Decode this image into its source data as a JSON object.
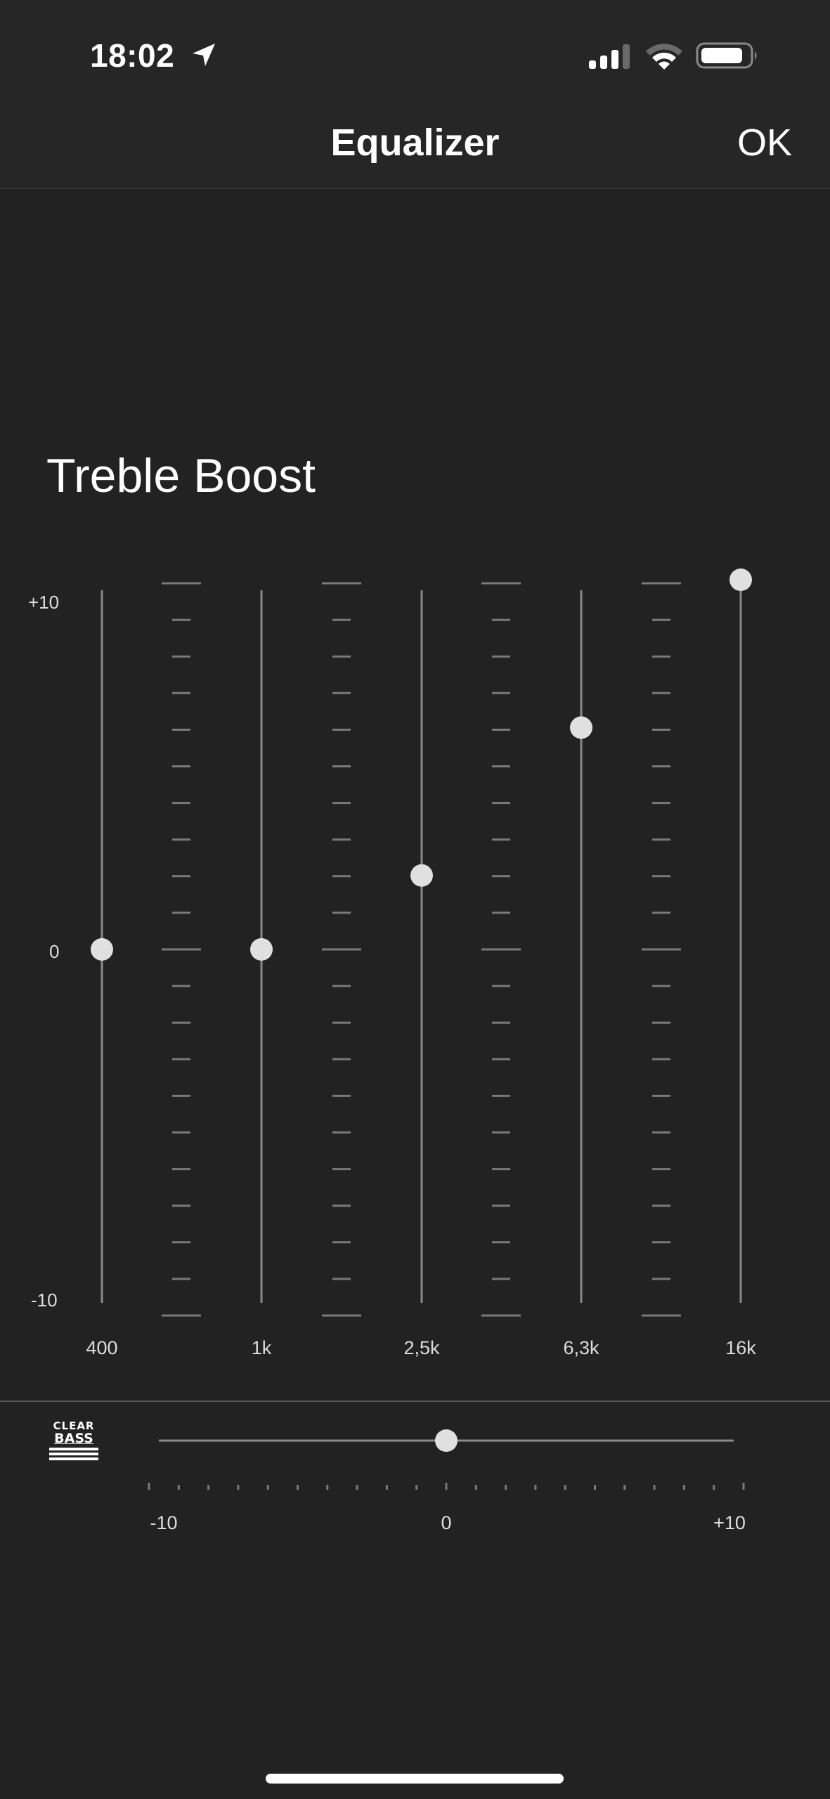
{
  "status_bar": {
    "time": "18:02",
    "icons": [
      "location-arrow-icon",
      "signal-icon",
      "wifi-icon",
      "battery-icon"
    ]
  },
  "nav": {
    "title": "Equalizer",
    "ok_label": "OK"
  },
  "preset": {
    "name": "Treble Boost"
  },
  "equalizer": {
    "scale_max_label": "+10",
    "scale_mid_label": "0",
    "scale_min_label": "-10",
    "range": [
      -10,
      10
    ],
    "bands": [
      {
        "label": "400",
        "value": 0
      },
      {
        "label": "1k",
        "value": 0
      },
      {
        "label": "2,5k",
        "value": 2
      },
      {
        "label": "6,3k",
        "value": 6
      },
      {
        "label": "16k",
        "value": 10
      }
    ]
  },
  "clear_bass": {
    "logo_top": "CLEAR",
    "logo_bottom": "BASS",
    "value": 0,
    "range": [
      -10,
      10
    ],
    "min_label": "-10",
    "mid_label": "0",
    "max_label": "+10"
  },
  "colors": {
    "background": "#222222",
    "bar_background": "#262626",
    "knob": "#e0e0e0",
    "track": "#8a8a8a",
    "tick": "#7a7a7a"
  }
}
